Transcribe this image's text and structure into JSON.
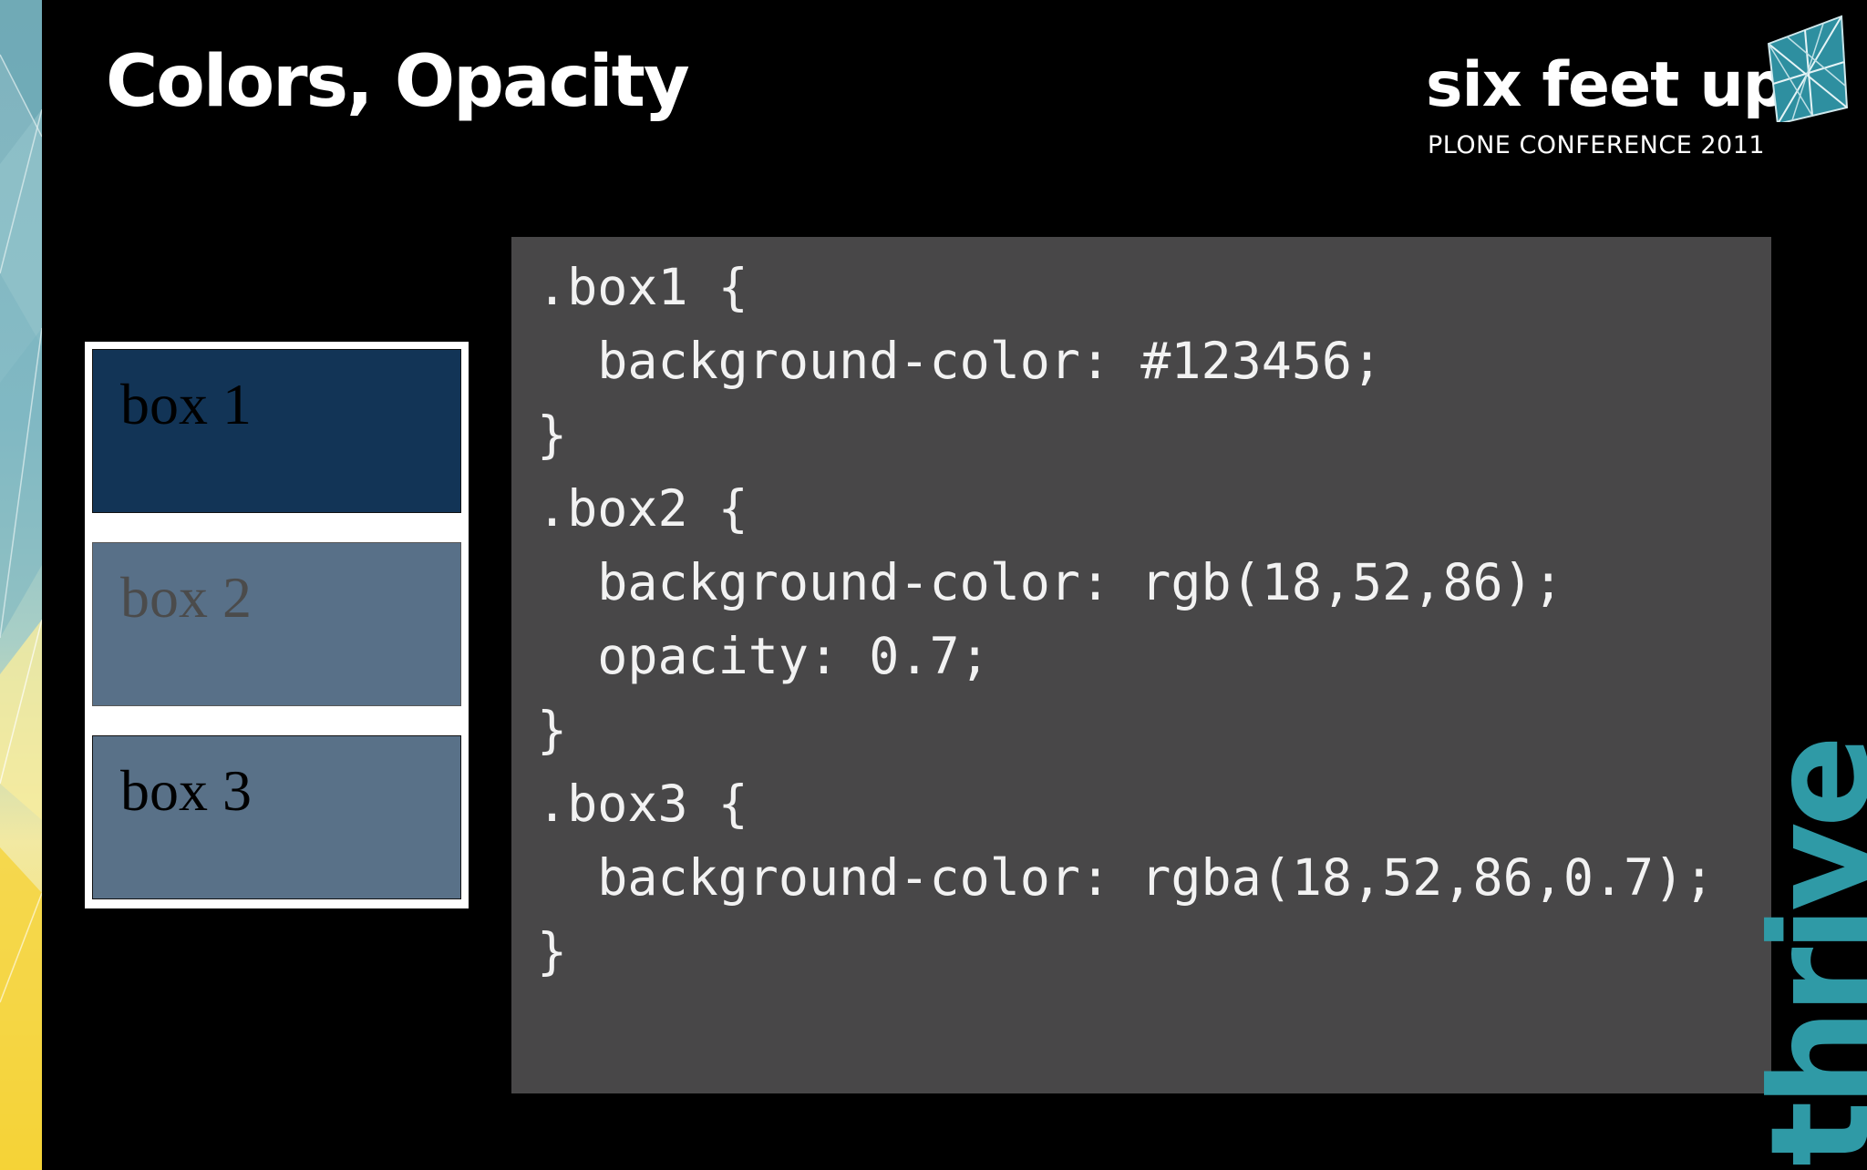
{
  "slide": {
    "title": "Colors, Opacity"
  },
  "brand": {
    "name": "six feet up",
    "subtitle": "PLONE CONFERENCE 2011",
    "logo_icon": "geometric-mesh-icon"
  },
  "side_word": "thrive",
  "demo": {
    "boxes": [
      {
        "label": "box 1",
        "color": "#123456",
        "opacity": 1
      },
      {
        "label": "box 2",
        "color": "rgb(18,52,86)",
        "opacity": 0.7
      },
      {
        "label": "box 3",
        "color": "rgba(18,52,86,0.7)",
        "opacity": 1
      }
    ]
  },
  "code": {
    "lines": [
      ".box1 {",
      "  background-color: #123456;",
      "}",
      ".box2 {",
      "  background-color: rgb(18,52,86);",
      "  opacity: 0.7;",
      "}",
      ".box3 {",
      "  background-color: rgba(18,52,86,0.7);",
      "}"
    ]
  },
  "colors": {
    "background": "#000000",
    "code_panel": "#484748",
    "code_text": "#f2f2f2",
    "box_color": "#123456",
    "accent_teal": "#2f9aa6",
    "accent_yellow": "#f5d33a"
  }
}
